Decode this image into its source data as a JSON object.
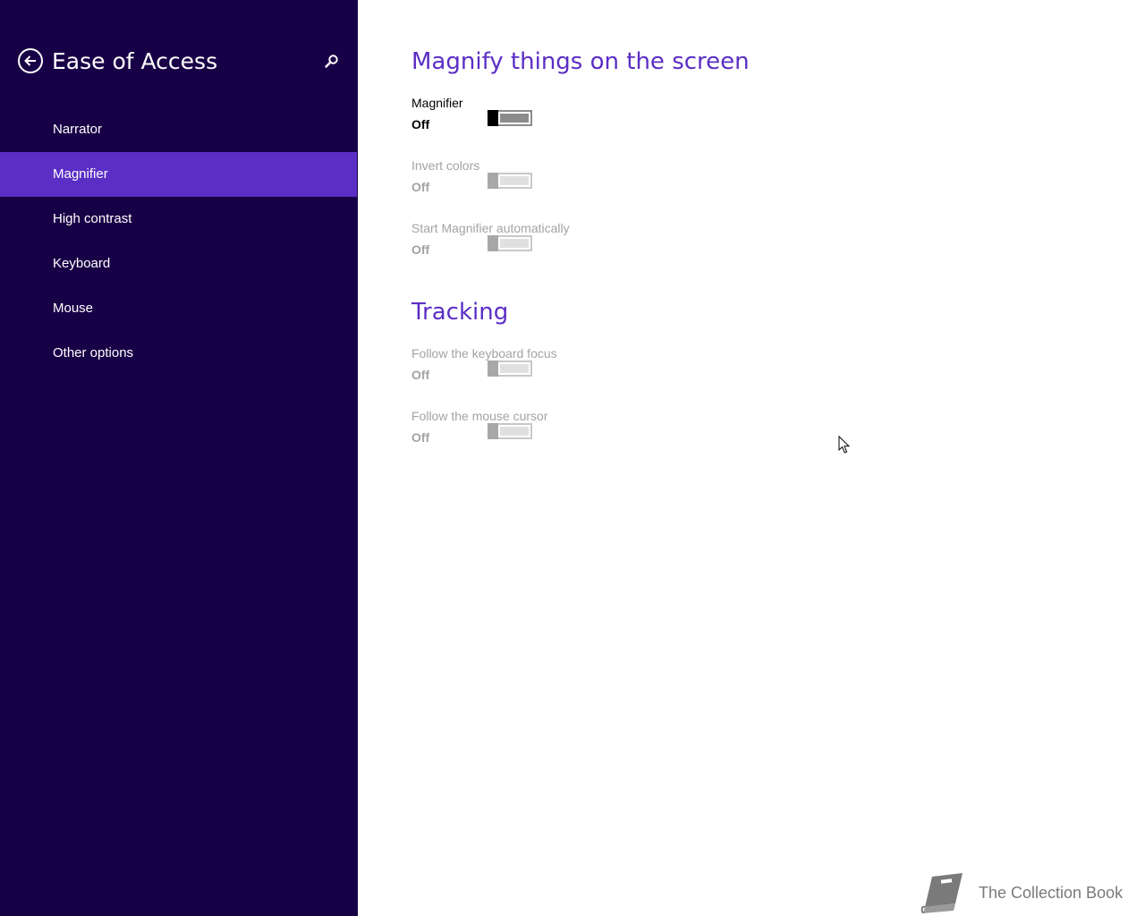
{
  "sidebar": {
    "title": "Ease of Access",
    "back_icon": "back-arrow-icon",
    "search_icon": "search-icon",
    "items": [
      {
        "label": "Narrator",
        "active": false
      },
      {
        "label": "Magnifier",
        "active": true
      },
      {
        "label": "High contrast",
        "active": false
      },
      {
        "label": "Keyboard",
        "active": false
      },
      {
        "label": "Mouse",
        "active": false
      },
      {
        "label": "Other options",
        "active": false
      }
    ]
  },
  "main": {
    "section_magnify": {
      "title": "Magnify things on the screen",
      "settings": [
        {
          "label": "Magnifier",
          "state": "Off",
          "enabled": true
        },
        {
          "label": "Invert colors",
          "state": "Off",
          "enabled": false
        },
        {
          "label": "Start Magnifier automatically",
          "state": "Off",
          "enabled": false
        }
      ]
    },
    "section_tracking": {
      "title": "Tracking",
      "settings": [
        {
          "label": "Follow the keyboard focus",
          "state": "Off",
          "enabled": false
        },
        {
          "label": "Follow the mouse cursor",
          "state": "Off",
          "enabled": false
        }
      ]
    }
  },
  "watermark": {
    "text": "The Collection Book",
    "icon": "book-icon"
  },
  "colors": {
    "sidebar_bg": "#180046",
    "accent": "#5b2ec5",
    "disabled_text": "#a3a3a3"
  }
}
